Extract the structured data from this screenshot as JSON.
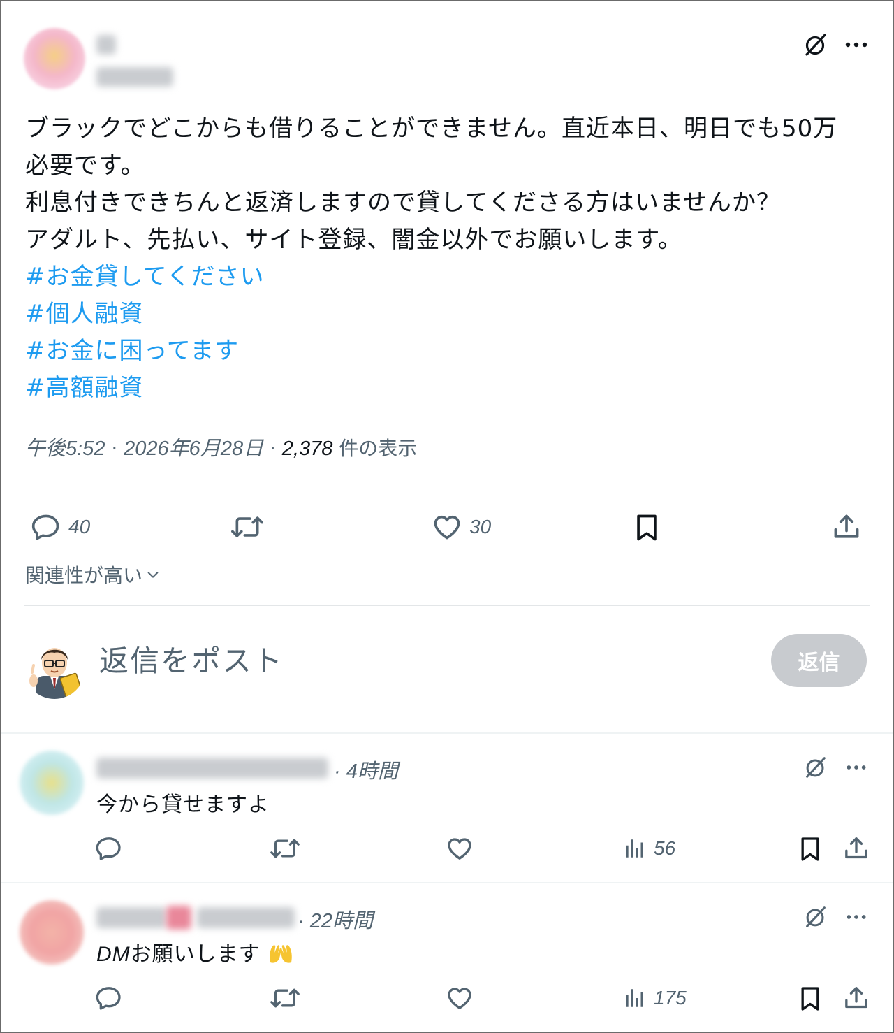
{
  "post": {
    "text_lines": [
      "ブラックでどこからも借りることができません。直近本日、明日でも50万",
      "必要です。",
      "利息付きできちんと返済しますので貸してくださる方はいませんか？",
      "アダルト、先払い、サイト登録、闇金以外でお願いします。"
    ],
    "hashtags": [
      "#お金貸してください",
      "#個人融資",
      "#お金に困ってます",
      "#高額融資"
    ],
    "time": "午後5:52",
    "date": "2026年6月28日",
    "views": "2,378",
    "views_label": "件の表示",
    "reply_count": "40",
    "like_count": "30",
    "icons": [
      "grok-icon",
      "more-icon",
      "reply-icon",
      "repost-icon",
      "like-icon",
      "bookmark-icon",
      "share-icon"
    ]
  },
  "sort": {
    "label": "関連性が高い"
  },
  "composer": {
    "placeholder": "返信をポスト",
    "button_label": "返信"
  },
  "comments": [
    {
      "time": "4時間",
      "text": "今から貸せますよ",
      "views": "56"
    },
    {
      "time": "22時間",
      "text_prefix": "DM",
      "text": "お願いします",
      "views": "175"
    }
  ],
  "colors": {
    "hashtag": "#1d9bf0",
    "secondary_text": "#536471",
    "reply_button_disabled": "#c8cbcf"
  }
}
